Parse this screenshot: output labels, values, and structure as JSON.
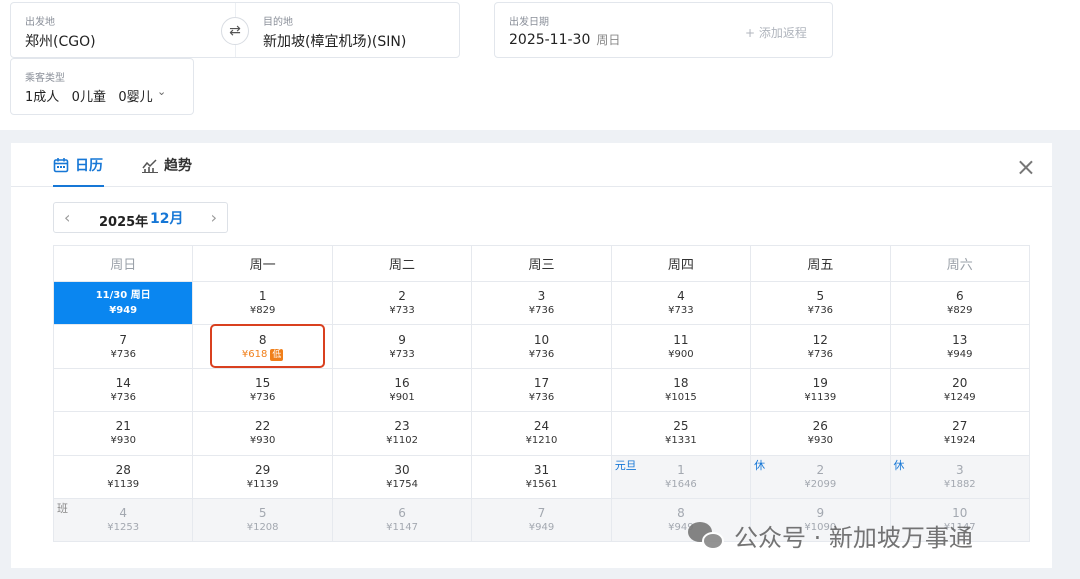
{
  "search": {
    "origin_label": "出发地",
    "origin_value": "郑州(CGO)",
    "dest_label": "目的地",
    "dest_value": "新加坡(樟宜机场)(SIN)",
    "swap_glyph": "⇄",
    "date_label": "出发日期",
    "date_value": "2025-11-30",
    "date_weekday": "周日",
    "add_return": "+ 添加返程",
    "pax_label": "乘客类型",
    "pax_value": "1成人   0儿童   0婴儿",
    "pax_chevron": "⌄"
  },
  "tabs": {
    "calendar": "日历",
    "trend": "趋势",
    "close": "×"
  },
  "month_nav": {
    "prev": "‹",
    "year": "2025年",
    "month": "12月",
    "next": "›"
  },
  "weekdays": [
    "周日",
    "周一",
    "周二",
    "周三",
    "周四",
    "周五",
    "周六"
  ],
  "weeks": [
    [
      {
        "day": "11/30 周日",
        "price": "¥949",
        "state": "selected"
      },
      {
        "day": "1",
        "price": "¥829"
      },
      {
        "day": "2",
        "price": "¥733"
      },
      {
        "day": "3",
        "price": "¥736"
      },
      {
        "day": "4",
        "price": "¥733"
      },
      {
        "day": "5",
        "price": "¥736"
      },
      {
        "day": "6",
        "price": "¥829"
      }
    ],
    [
      {
        "day": "7",
        "price": "¥736"
      },
      {
        "day": "8",
        "price": "¥618",
        "state": "lowest",
        "badge": "低"
      },
      {
        "day": "9",
        "price": "¥733"
      },
      {
        "day": "10",
        "price": "¥736"
      },
      {
        "day": "11",
        "price": "¥900"
      },
      {
        "day": "12",
        "price": "¥736"
      },
      {
        "day": "13",
        "price": "¥949"
      }
    ],
    [
      {
        "day": "14",
        "price": "¥736"
      },
      {
        "day": "15",
        "price": "¥736"
      },
      {
        "day": "16",
        "price": "¥901"
      },
      {
        "day": "17",
        "price": "¥736"
      },
      {
        "day": "18",
        "price": "¥1015"
      },
      {
        "day": "19",
        "price": "¥1139"
      },
      {
        "day": "20",
        "price": "¥1249"
      }
    ],
    [
      {
        "day": "21",
        "price": "¥930"
      },
      {
        "day": "22",
        "price": "¥930"
      },
      {
        "day": "23",
        "price": "¥1102"
      },
      {
        "day": "24",
        "price": "¥1210"
      },
      {
        "day": "25",
        "price": "¥1331"
      },
      {
        "day": "26",
        "price": "¥930"
      },
      {
        "day": "27",
        "price": "¥1924"
      }
    ],
    [
      {
        "day": "28",
        "price": "¥1139"
      },
      {
        "day": "29",
        "price": "¥1139"
      },
      {
        "day": "30",
        "price": "¥1754"
      },
      {
        "day": "31",
        "price": "¥1561"
      },
      {
        "day": "1",
        "price": "¥1646",
        "state": "other",
        "tag": "元旦",
        "tag_type": "hol"
      },
      {
        "day": "2",
        "price": "¥2099",
        "state": "other",
        "tag": "休",
        "tag_type": "hol"
      },
      {
        "day": "3",
        "price": "¥1882",
        "state": "other",
        "tag": "休",
        "tag_type": "hol"
      }
    ],
    [
      {
        "day": "4",
        "price": "¥1253",
        "state": "other",
        "tag": "班",
        "tag_type": "work"
      },
      {
        "day": "5",
        "price": "¥1208",
        "state": "other"
      },
      {
        "day": "6",
        "price": "¥1147",
        "state": "other"
      },
      {
        "day": "7",
        "price": "¥949",
        "state": "other"
      },
      {
        "day": "8",
        "price": "¥949",
        "state": "other"
      },
      {
        "day": "9",
        "price": "¥1090",
        "state": "other"
      },
      {
        "day": "10",
        "price": "¥1147",
        "state": "other"
      }
    ]
  ],
  "watermark": "公众号 · 新加坡万事通",
  "colors": {
    "accent": "#1677d6",
    "selected_bg": "#0a86f0",
    "low_price": "#f07f1a",
    "highlight_box": "#d9401f"
  }
}
